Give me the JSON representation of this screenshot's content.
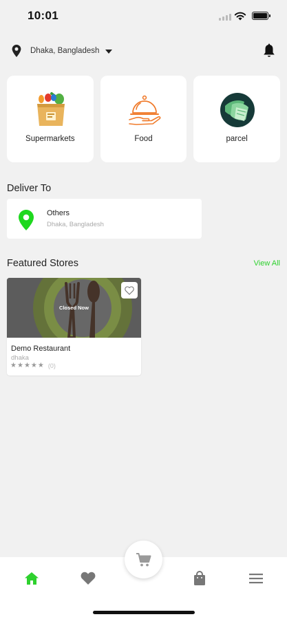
{
  "status_bar": {
    "time": "10:01"
  },
  "location": {
    "text": "Dhaka, Bangladesh"
  },
  "categories": [
    {
      "label": "Supermarkets",
      "icon": "grocery-bag-icon"
    },
    {
      "label": "Food",
      "icon": "food-cloche-icon"
    },
    {
      "label": "parcel",
      "icon": "parcel-icon"
    }
  ],
  "deliver": {
    "title": "Deliver To",
    "name": "Others",
    "address": "Dhaka, Bangladesh"
  },
  "featured": {
    "title": "Featured Stores",
    "view_all": "View All",
    "stores": [
      {
        "name": "Demo Restaurant",
        "area": "dhaka",
        "status": "Closed Now",
        "rating": 0,
        "rating_count": "(0)"
      }
    ]
  },
  "bottom_nav": [
    "home-icon",
    "heart-icon",
    "cart-icon",
    "shopping-bag-icon",
    "menu-icon"
  ],
  "colors": {
    "accent_green": "#2ed12e",
    "background": "#f1f1f1",
    "icon_gray": "#777777",
    "food_orange": "#f07a2a"
  }
}
